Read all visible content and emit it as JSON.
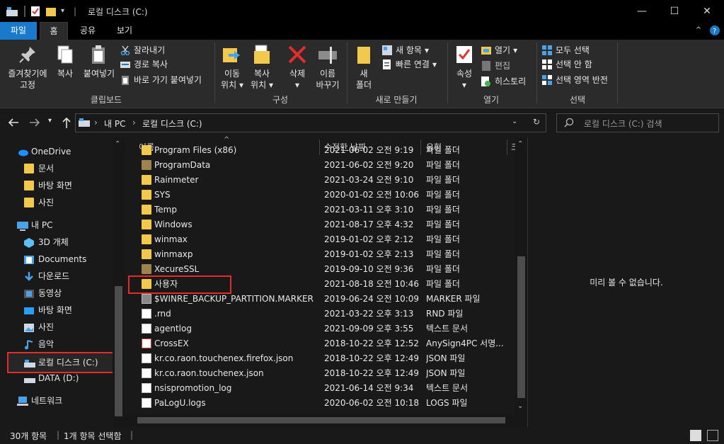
{
  "window": {
    "title": "로컬 디스크 (C:)",
    "minimize": "—",
    "maximize": "☐",
    "close": "✕"
  },
  "ribbon_tabs": [
    "파일",
    "홈",
    "공유",
    "보기"
  ],
  "ribbon": {
    "clipboard": {
      "pin_quick_access_l1": "즐겨찾기에",
      "pin_quick_access_l2": "고정",
      "copy": "복사",
      "paste": "붙여넣기",
      "cut": "잘라내기",
      "copy_path": "경로 복사",
      "paste_shortcut": "바로 가기 붙여넣기",
      "group_label": "클립보드"
    },
    "organize": {
      "move_to_l1": "이동",
      "move_to_l2": "위치",
      "copy_to_l1": "복사",
      "copy_to_l2": "위치",
      "delete": "삭제",
      "rename_l1": "이름",
      "rename_l2": "바꾸기",
      "group_label": "구성"
    },
    "new": {
      "new_folder_l1": "새",
      "new_folder_l2": "폴더",
      "new_item": "새 항목",
      "easy_access": "빠른 연결",
      "group_label": "새로 만들기"
    },
    "open": {
      "properties": "속성",
      "open": "열기",
      "edit": "편집",
      "history": "히스토리",
      "group_label": "열기"
    },
    "select": {
      "select_all": "모두 선택",
      "select_none": "선택 안 함",
      "invert_selection": "선택 영역 반전",
      "group_label": "선택"
    }
  },
  "address": {
    "crumbs": [
      "내 PC",
      "로컬 디스크 (C:)"
    ],
    "search_placeholder": "로컬 디스크 (C:) 검색"
  },
  "nav_pane": {
    "items": [
      {
        "label": "OneDrive",
        "icon": "cloud-icon"
      },
      {
        "label": "문서",
        "icon": "folder-icon"
      },
      {
        "label": "바탕 화면",
        "icon": "folder-icon"
      },
      {
        "label": "사진",
        "icon": "folder-icon"
      },
      {
        "label": "내 PC",
        "icon": "computer-icon"
      },
      {
        "label": "3D 개체",
        "icon": "cube-icon"
      },
      {
        "label": "Documents",
        "icon": "documents-icon"
      },
      {
        "label": "다운로드",
        "icon": "download-icon"
      },
      {
        "label": "동영상",
        "icon": "video-icon"
      },
      {
        "label": "바탕 화면",
        "icon": "desktop-icon"
      },
      {
        "label": "사진",
        "icon": "pictures-icon"
      },
      {
        "label": "음악",
        "icon": "music-icon"
      },
      {
        "label": "로컬 디스크 (C:)",
        "icon": "drive-c-icon"
      },
      {
        "label": "DATA (D:)",
        "icon": "drive-icon"
      },
      {
        "label": "네트워크",
        "icon": "network-icon"
      }
    ]
  },
  "columns": {
    "name": "이름",
    "date": "수정한 날짜",
    "type": "유형",
    "size": "크"
  },
  "files": [
    {
      "name": "Program Files (x86)",
      "date": "2021-06-02 오전 9:19",
      "type": "파일 폴더",
      "kind": "folder"
    },
    {
      "name": "ProgramData",
      "date": "2021-06-02 오전 9:20",
      "type": "파일 폴더",
      "kind": "folder-dim"
    },
    {
      "name": "Rainmeter",
      "date": "2021-03-24 오전 9:10",
      "type": "파일 폴더",
      "kind": "folder"
    },
    {
      "name": "SYS",
      "date": "2020-01-02 오전 10:06",
      "type": "파일 폴더",
      "kind": "folder"
    },
    {
      "name": "Temp",
      "date": "2021-03-11 오후 3:10",
      "type": "파일 폴더",
      "kind": "folder"
    },
    {
      "name": "Windows",
      "date": "2021-08-17 오후 4:32",
      "type": "파일 폴더",
      "kind": "folder"
    },
    {
      "name": "winmax",
      "date": "2019-01-02 오후 2:12",
      "type": "파일 폴더",
      "kind": "folder"
    },
    {
      "name": "winmaxp",
      "date": "2019-01-02 오후 2:13",
      "type": "파일 폴더",
      "kind": "folder"
    },
    {
      "name": "XecureSSL",
      "date": "2019-09-10 오전 9:36",
      "type": "파일 폴더",
      "kind": "folder-dim"
    },
    {
      "name": "사용자",
      "date": "2021-08-18 오전 10:46",
      "type": "파일 폴더",
      "kind": "folder"
    },
    {
      "name": "$WINRE_BACKUP_PARTITION.MARKER",
      "date": "2019-06-24 오전 10:09",
      "type": "MARKER 파일",
      "kind": "file-dim"
    },
    {
      "name": ".rnd",
      "date": "2021-03-22 오후 3:13",
      "type": "RND 파일",
      "kind": "file"
    },
    {
      "name": "agentlog",
      "date": "2021-09-09 오후 3:55",
      "type": "텍스트 문서",
      "kind": "file"
    },
    {
      "name": "CrossEX",
      "date": "2018-10-22 오후 12:52",
      "type": "AnySign4PC 서명...",
      "kind": "app"
    },
    {
      "name": "kr.co.raon.touchenex.firefox.json",
      "date": "2018-10-22 오후 12:49",
      "type": "JSON 파일",
      "kind": "file"
    },
    {
      "name": "kr.co.raon.touchenex.json",
      "date": "2018-10-22 오후 12:49",
      "type": "JSON 파일",
      "kind": "file"
    },
    {
      "name": "nsispromotion_log",
      "date": "2021-06-14 오전 9:34",
      "type": "텍스트 문서",
      "kind": "file"
    },
    {
      "name": "PaLogU.logs",
      "date": "2020-06-02 오전 10:18",
      "type": "LOGS 파일",
      "kind": "file"
    }
  ],
  "preview": {
    "message": "미리 볼 수 없습니다."
  },
  "status": {
    "item_count": "30개 항목",
    "selected": "1개 항목 선택함"
  }
}
